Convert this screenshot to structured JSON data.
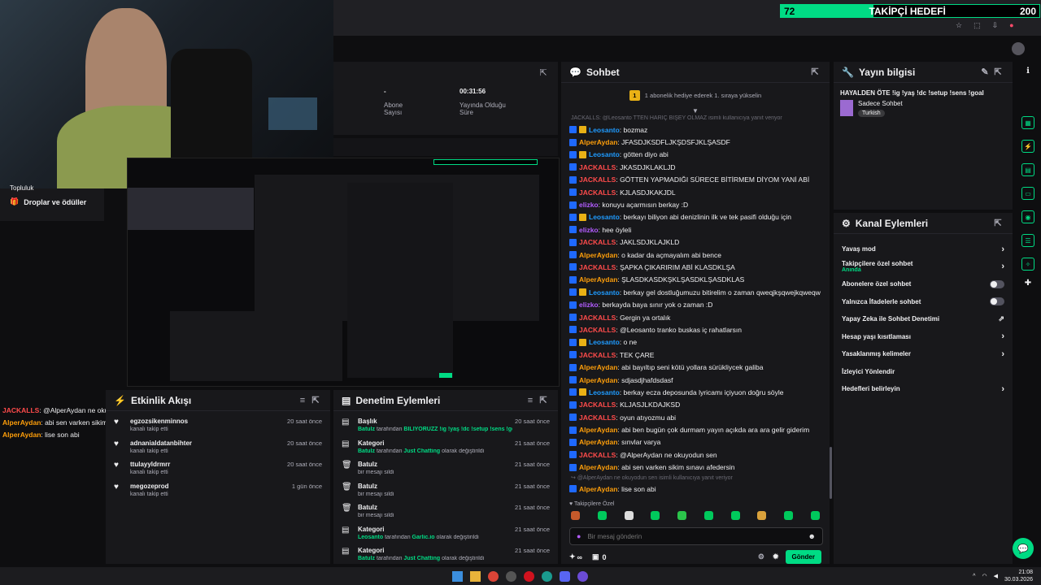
{
  "follower_goal": {
    "count": "72",
    "label": "TAKİPÇİ HEDEFİ",
    "value": "200"
  },
  "stats": {
    "subs_value": "-",
    "subs_label": "Abone Sayısı",
    "live_value": "00:31:56",
    "live_label": "Yayında Olduğu Süre"
  },
  "left_nav": {
    "item1": "Topluluk",
    "item2": "Droplar ve ödüller"
  },
  "overlay_chat": [
    {
      "user": "JACKALLS",
      "user_color": "#ff4b4b",
      "text": ": @AlperAydan ne okuyodun sen"
    },
    {
      "user": "AlperAydan",
      "user_color": "#ff9f0a",
      "text": ": abi sen varken sikim sınavı afedersin"
    },
    {
      "user": "AlperAydan",
      "user_color": "#ff9f0a",
      "text": ": lise son abi"
    }
  ],
  "activity": {
    "title": "Etkinlik Akışı",
    "items": [
      {
        "name": "egzozsikenminnos",
        "action": "kanalı takip etti",
        "time": "20 saat önce"
      },
      {
        "name": "adnanialdatanbihter",
        "action": "kanalı takip etti",
        "time": "20 saat önce"
      },
      {
        "name": "ttulayyldrmrr",
        "action": "kanalı takip etti",
        "time": "20 saat önce"
      },
      {
        "name": "megozeprod",
        "action": "kanalı takip etti",
        "time": "1 gün önce"
      }
    ]
  },
  "moderation": {
    "title": "Denetim Eylemleri",
    "items": [
      {
        "title": "Başlık",
        "actor": "Batulz",
        "mid": " tarafından ",
        "obj": "BİLİYORUZZ !ig !yaş !dc !setup !sens !goal",
        "tail": " olarak değiştirildi",
        "time": "20 saat önce",
        "icon": "📄"
      },
      {
        "title": "Kategori",
        "actor": "Batulz",
        "mid": " tarafından ",
        "obj": "Just Chatting",
        "tail": " olarak değiştirildi",
        "time": "21 saat önce",
        "icon": "📄"
      },
      {
        "title": "Batulz",
        "actor": "",
        "mid": "",
        "obj": "",
        "tail": "bir mesajı sildi",
        "time": "21 saat önce",
        "icon": "🗑"
      },
      {
        "title": "Batulz",
        "actor": "",
        "mid": "",
        "obj": "",
        "tail": "bir mesajı sildi",
        "time": "21 saat önce",
        "icon": "🗑"
      },
      {
        "title": "Batulz",
        "actor": "",
        "mid": "",
        "obj": "",
        "tail": "bir mesajı sildi",
        "time": "21 saat önce",
        "icon": "🗑"
      },
      {
        "title": "Kategori",
        "actor": "Leosanto",
        "mid": " tarafından ",
        "obj": "Garlic.io",
        "tail": " olarak değiştirildi",
        "time": "21 saat önce",
        "icon": "📄"
      },
      {
        "title": "Kategori",
        "actor": "Batulz",
        "mid": " tarafından ",
        "obj": "Just Chatting",
        "tail": " olarak değiştirildi",
        "time": "21 saat önce",
        "icon": "📄"
      }
    ]
  },
  "chat": {
    "title": "Sohbet",
    "pinned": "1 abonelik hediye ederek 1. sıraya yükselin",
    "pinned_num": "1",
    "reply_hint": "JACKALLS: @Leosanto TTEN HARİÇ BİŞEY OLMAZ isimli kullanıcıya yanıt veriyor",
    "messages": [
      {
        "user": "Leosanto",
        "color": "#1f9bff",
        "badge": "blue-gold",
        "text": ": bozmaz"
      },
      {
        "user": "AlperAydan",
        "color": "#ff9f0a",
        "badge": "blue",
        "text": ": JFASDJKSDFLJKŞDSFJKLŞASDF"
      },
      {
        "user": "Leosanto",
        "color": "#1f9bff",
        "badge": "blue-gold",
        "text": ": götten diyo abi"
      },
      {
        "user": "JACKALLS",
        "color": "#ff4b4b",
        "badge": "blue",
        "text": ": JKASDJKLAKLJD"
      },
      {
        "user": "JACKALLS",
        "color": "#ff4b4b",
        "badge": "blue",
        "text": ": GÖTTEN YAPMADIĞI SÜRECE BİTİRMEM DİYOM YANİ ABİ"
      },
      {
        "user": "JACKALLS",
        "color": "#ff4b4b",
        "badge": "blue",
        "text": ": KJLASDJKAKJDL"
      },
      {
        "user": "elizko",
        "color": "#b35cff",
        "badge": "blue",
        "text": ": konuyu açarmısın berkay :D"
      },
      {
        "user": "Leosanto",
        "color": "#1f9bff",
        "badge": "blue-gold",
        "text": ": berkayı biliyon abi denizlinin ilk ve tek pasifi olduğu için"
      },
      {
        "user": "elizko",
        "color": "#b35cff",
        "badge": "blue",
        "text": ": hee öyleli"
      },
      {
        "user": "JACKALLS",
        "color": "#ff4b4b",
        "badge": "blue",
        "text": ": JAKLSDJKLAJKLD"
      },
      {
        "user": "AlperAydan",
        "color": "#ff9f0a",
        "badge": "blue",
        "text": ": o kadar da açmayalım abi bence"
      },
      {
        "user": "JACKALLS",
        "color": "#ff4b4b",
        "badge": "blue",
        "text": ": ŞAPKA ÇIKARIRIM ABİ KLASDKLŞA"
      },
      {
        "user": "AlperAydan",
        "color": "#ff9f0a",
        "badge": "blue",
        "text": ": ŞLASDKASDKŞKLŞASDKLŞASDKLAS"
      },
      {
        "user": "Leosanto",
        "color": "#1f9bff",
        "badge": "blue-gold",
        "text": ": berkay gel dostluğumuzu bitirelim o zaman qweqjkşqwejkqweqw"
      },
      {
        "user": "elizko",
        "color": "#b35cff",
        "badge": "blue",
        "text": ": berkayda baya sınır yok o zaman :D"
      },
      {
        "user": "JACKALLS",
        "color": "#ff4b4b",
        "badge": "blue",
        "text": ": Gergin ya ortalık"
      },
      {
        "user": "JACKALLS",
        "color": "#ff4b4b",
        "badge": "blue",
        "text": ": @Leosanto tranko buskas iç rahatlarsın"
      },
      {
        "user": "Leosanto",
        "color": "#1f9bff",
        "badge": "blue-gold",
        "text": ": o ne"
      },
      {
        "user": "JACKALLS",
        "color": "#ff4b4b",
        "badge": "blue",
        "text": ": TEK ÇARE"
      },
      {
        "user": "AlperAydan",
        "color": "#ff9f0a",
        "badge": "blue",
        "text": ": abi bayıltıp seni kötü yollara sürükliycek galiba"
      },
      {
        "user": "AlperAydan",
        "color": "#ff9f0a",
        "badge": "blue",
        "text": ": sdjasdjhafdsdasf"
      },
      {
        "user": "Leosanto",
        "color": "#1f9bff",
        "badge": "blue-gold",
        "text": ": berkay ecza deposunda lyricamı içiyuon doğru söyle"
      },
      {
        "user": "JACKALLS",
        "color": "#ff4b4b",
        "badge": "blue",
        "text": ": KLJASJLKDAJKSD"
      },
      {
        "user": "JACKALLS",
        "color": "#ff4b4b",
        "badge": "blue",
        "text": ": oyun atıyozmu abi"
      },
      {
        "user": "AlperAydan",
        "color": "#ff9f0a",
        "badge": "blue",
        "text": ": abi ben bugün çok durmam yayın açıkda ara ara gelir giderim"
      },
      {
        "user": "AlperAydan",
        "color": "#ff9f0a",
        "badge": "blue",
        "text": ": sınvlar varya"
      },
      {
        "user": "JACKALLS",
        "color": "#ff4b4b",
        "badge": "blue",
        "text": ": @AlperAydan ne okuyodun sen"
      },
      {
        "user": "AlperAydan",
        "color": "#ff9f0a",
        "badge": "blue",
        "text": ": abi sen varken sikim sınavı afedersin"
      }
    ],
    "reply_hint2": "@AlperAydan ne okuyodun sen isimli kullanıcıya yanıt veriyor",
    "last": {
      "user": "AlperAydan",
      "color": "#ff9f0a",
      "text": ": lise son abi"
    },
    "emote_label": "Takipçilere Özel",
    "input_placeholder": "Bir mesaj gönderin",
    "inf_label": "∞",
    "gift_count": "0",
    "send_label": "Gönder"
  },
  "stream_info": {
    "title": "Yayın bilgisi",
    "stream_title": "HAYALDEN ÖTE !ig !yaş !dc !setup !sens !goal",
    "chat_mode": "Sadece Sohbet",
    "language": "Turkish"
  },
  "channel_actions": {
    "title": "Kanal Eylemleri",
    "items": [
      {
        "label": "Yavaş mod",
        "sub": "",
        "ctrl": "chev"
      },
      {
        "label": "Takipçilere özel sohbet",
        "sub": "Anında",
        "ctrl": "chev"
      },
      {
        "label": "Abonelere özel sohbet",
        "sub": "",
        "ctrl": "toggle"
      },
      {
        "label": "Yalnızca İfadelerle sohbet",
        "sub": "",
        "ctrl": "toggle"
      },
      {
        "label": "Yapay Zeka ile Sohbet Denetimi",
        "sub": "",
        "ctrl": "ext"
      },
      {
        "label": "Hesap yaşı kısıtlaması",
        "sub": "",
        "ctrl": "chev"
      },
      {
        "label": "Yasaklanmış kelimeler",
        "sub": "",
        "ctrl": "chev"
      },
      {
        "label": "İzleyici Yönlendir",
        "sub": "",
        "ctrl": "none"
      },
      {
        "label": "Hedefleri belirleyin",
        "sub": "",
        "ctrl": "chev"
      }
    ]
  },
  "taskbar": {
    "time": "21:08",
    "date": "30.03.2026"
  },
  "colors": {
    "accent": "#00db84",
    "bg": "#0e0e10",
    "panel": "#18181b"
  }
}
